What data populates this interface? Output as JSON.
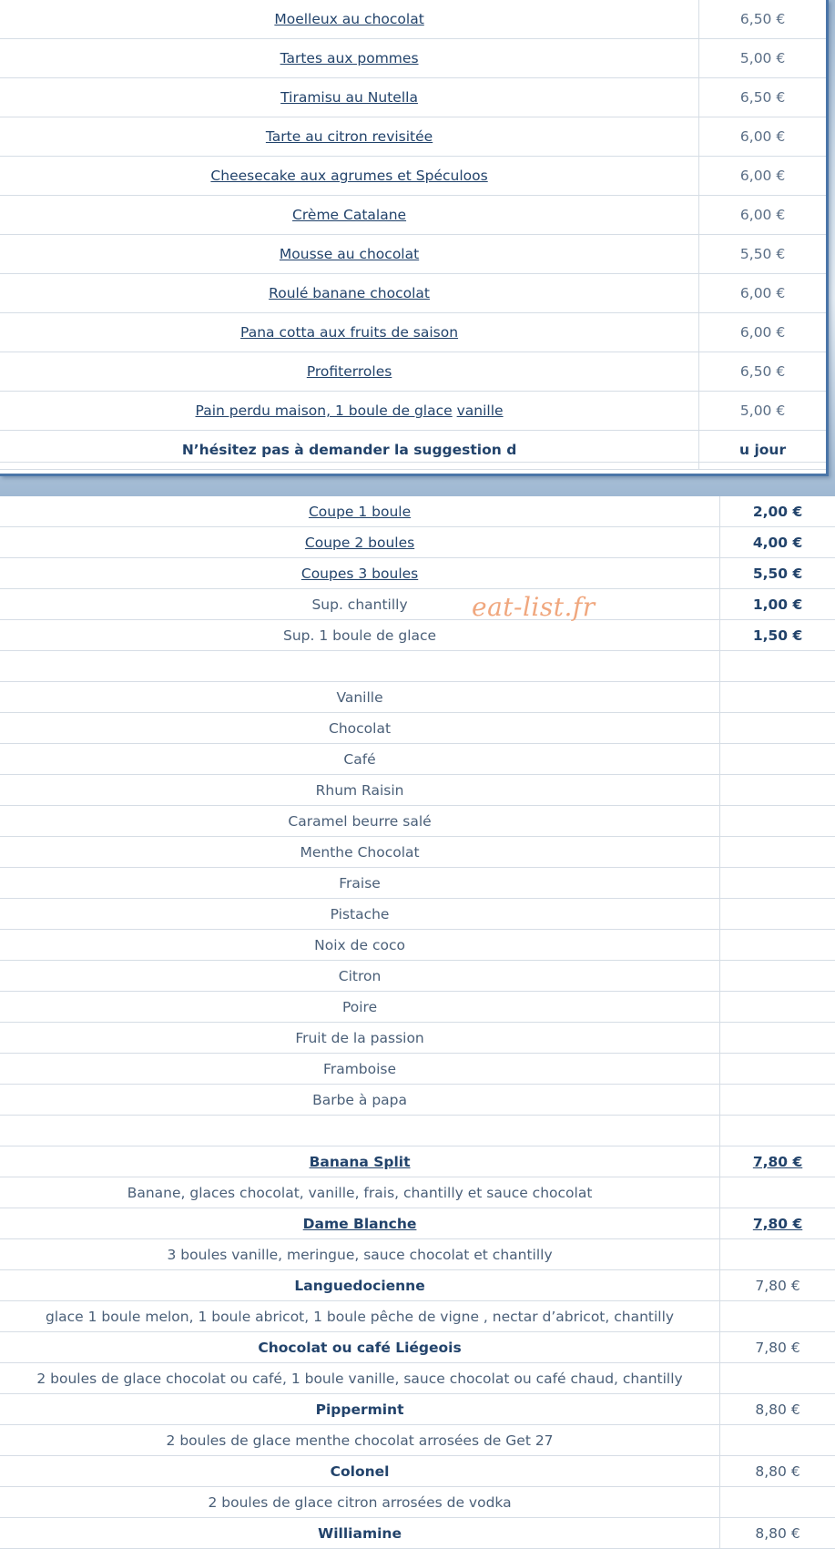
{
  "desserts": [
    {
      "name": "Moelleux au chocolat",
      "price": "6,50 €",
      "link": true
    },
    {
      "name": "Tartes aux pommes",
      "price": "5,00 €",
      "link": true
    },
    {
      "name": "Tiramisu au Nutella",
      "price": "6,50 €",
      "link": true
    },
    {
      "name": "Tarte au citron revisitée",
      "price": "6,00 €",
      "link": true
    },
    {
      "name": "Cheesecake aux agrumes et Spéculoos",
      "price": "6,00 €",
      "link": true
    },
    {
      "name": "Crème Catalane",
      "price": "6,00 €",
      "link": true
    },
    {
      "name": "Mousse au chocolat",
      "price": "5,50 €",
      "link": true
    },
    {
      "name": "Roulé banane chocolat",
      "price": "6,00 €",
      "link": true
    },
    {
      "name": "Pana cotta aux fruits de saison",
      "price": "6,00 €",
      "link": true
    },
    {
      "name": "Profiterroles",
      "price": "6,50 €",
      "link": true
    },
    {
      "name_part1": "Pain perdu maison, 1 boule de glace",
      "name_part2": "vanille",
      "price": "5,00 €"
    }
  ],
  "suggestion": {
    "left": "N’hésitez pas à demander la suggestion d",
    "right": "u jour"
  },
  "coupes": [
    {
      "name": "Coupe 1 boule",
      "price": "2,00 €"
    },
    {
      "name": "Coupe 2 boules",
      "price": "4,00 €"
    },
    {
      "name": "Coupes 3 boules",
      "price": "5,50 €"
    }
  ],
  "supplements": [
    {
      "name": "Sup. chantilly",
      "price": "1,00 €"
    },
    {
      "name": "Sup. 1 boule de glace",
      "price": "1,50 €"
    }
  ],
  "flavors": [
    "Vanille",
    "Chocolat",
    "Café",
    "Rhum Raisin",
    "Caramel beurre salé",
    "Menthe Chocolat",
    "Fraise",
    "Pistache",
    "Noix de coco",
    "Citron",
    "Poire",
    "Fruit de la passion",
    "Framboise",
    "Barbe à papa"
  ],
  "sundaes": [
    {
      "name": "Banana Split",
      "price": "7,80 €",
      "desc": "Banane, glaces chocolat, vanille, frais, chantilly et sauce chocolat"
    },
    {
      "name": "Dame Blanche",
      "price": "7,80 €",
      "desc": "3 boules vanille, meringue, sauce chocolat et chantilly"
    },
    {
      "name": "Languedocienne",
      "price": "7,80 €",
      "desc": "glace 1 boule melon, 1 boule abricot, 1 boule pêche de vigne , nectar d’abricot, chantilly"
    },
    {
      "name": "Chocolat ou café Liégeois",
      "price": "7,80 €",
      "desc": "2 boules de glace chocolat ou café, 1 boule vanille, sauce chocolat ou café chaud, chantilly"
    },
    {
      "name": "Pippermint",
      "price": "8,80 €",
      "desc": "2 boules de glace menthe chocolat arrosées de Get 27"
    },
    {
      "name": "Colonel",
      "price": "8,80 €",
      "desc": "2 boules de glace citron arrosées de vodka"
    },
    {
      "name": "Williamine",
      "price": "8,80 €"
    }
  ],
  "watermark": "eat-list.fr"
}
